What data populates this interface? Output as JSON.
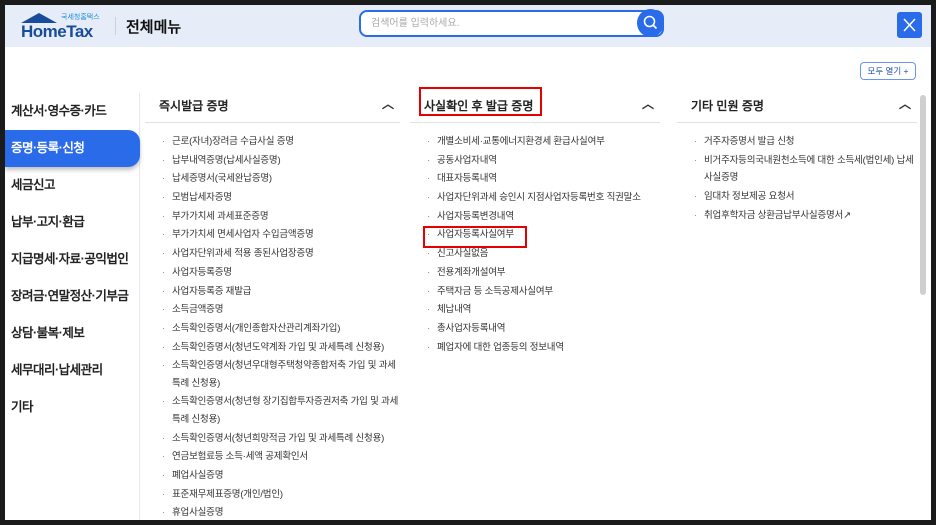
{
  "header": {
    "logo_sub": "국세청홈택스",
    "logo_main": "HomeTax",
    "title": "전체메뉴",
    "search_placeholder": "검색어를 입력하세요.",
    "close_label": "X"
  },
  "open_all": "모두 열기 +",
  "sidebar": [
    "계산서·영수증·카드",
    "증명·등록·신청",
    "세금신고",
    "납부·고지·환급",
    "지급명세·자료·공익법인",
    "장려금·연말정산·기부금",
    "상담·불복·제보",
    "세무대리·납세관리",
    "기타"
  ],
  "columns": [
    {
      "title": "즉시발급 증명",
      "items": [
        "근로(자녀)장려금 수급사실 증명",
        "납부내역증명(납세사실증명)",
        "납세증명서(국세완납증명)",
        "모범납세자증명",
        "부가가치세 과세표준증명",
        "부가가치세 면세사업자 수입금액증명",
        "사업자단위과세 적용 종된사업장증명",
        "사업자등록증명",
        "사업자등록증 재발급",
        "소득금액증명",
        "소득확인증명서(개인종합자산관리계좌가입)",
        "소득확인증명서(청년도약계좌 가입 및 과세특례 신청용)",
        "소득확인증명서(청년우대형주택청약종합저축 가입 및 과세특례 신청용)",
        "소득확인증명서(청년형 장기집합투자증권저축 가입 및 과세특례 신청용)",
        "소득확인증명서(청년희망적금 가입 및 과세특례 신청용)",
        "연금보험료등 소득·세액 공제확인서",
        "폐업사실증명",
        "표준재무제표증명(개인/법인)",
        "휴업사실증명"
      ]
    },
    {
      "title": "사실확인 후 발급 증명",
      "items": [
        "개별소비세·교통에너지환경세 환급사실여부",
        "공동사업자내역",
        "대표자등록내역",
        "사업자단위과세 승인시 지점사업자등록번호 직권말소",
        "사업자등록변경내역",
        "사업자등록사실여부",
        "신고사실없음",
        "전용계좌개설여부",
        "주택자금 등 소득공제사실여부",
        "체납내역",
        "총사업자등록내역",
        "폐업자에 대한 업종등의 정보내역"
      ]
    },
    {
      "title": "기타 민원 증명",
      "items": [
        "거주자증명서 발급 신청",
        "비거주자등의국내원천소득에 대한 소득세(법인세) 납세사실증명",
        "임대차 정보제공 요청서",
        "취업후학자금 상환금납부사실증명서"
      ]
    }
  ],
  "colors": {
    "accent": "#2a6bea",
    "highlight": "#e60000"
  }
}
